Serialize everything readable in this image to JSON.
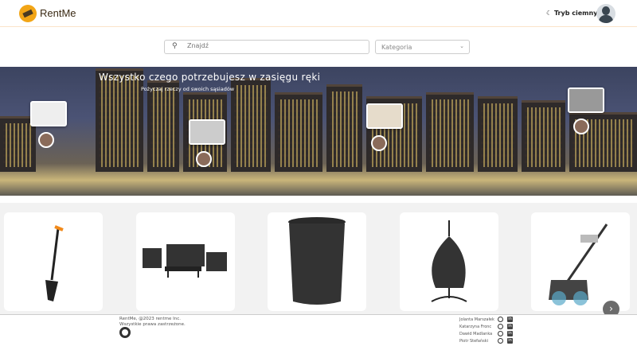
{
  "header": {
    "brand": "RentMe",
    "dark_mode_label": "Tryb ciemny",
    "dark_mode_icon": "moon-icon"
  },
  "search": {
    "placeholder": "Znajdź",
    "category_label": "Kategoria"
  },
  "hero": {
    "title": "Wszystko czego potrzebujesz w zasięgu ręki",
    "subtitle": "Pożyczaj rzeczy od swoich sąsiadów"
  },
  "products": [
    {
      "item": "spade"
    },
    {
      "item": "garden furniture set"
    },
    {
      "item": "rain barrel"
    },
    {
      "item": "hanging egg chair"
    },
    {
      "item": "tiller"
    }
  ],
  "footer": {
    "copyright": "RentMe, @2023 rentme Inc.",
    "rights": "Wszystkie prawa zastrzeżone.",
    "team": [
      "Jolanta Marszałek",
      "Katarzyna Fronc",
      "Dawid Madlanka",
      "Piotr Stefański"
    ]
  }
}
